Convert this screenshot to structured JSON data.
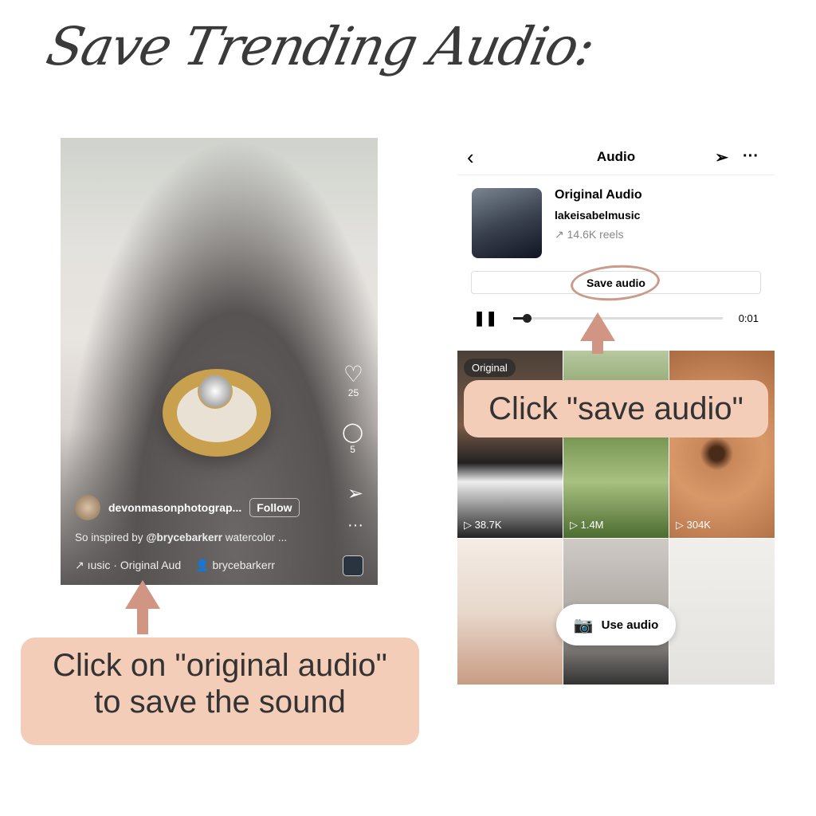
{
  "title": "Save Trending Audio:",
  "reel": {
    "likes": "25",
    "comments": "5",
    "username": "devonmasonphotograp...",
    "follow": "Follow",
    "caption_prefix": "So inspired by ",
    "caption_mention": "@brycebarkerr",
    "caption_suffix": " watercolor ...",
    "audio": "↗ ıusic · Original Aud",
    "tagged_user": "brycebarkerr"
  },
  "audio_page": {
    "header": "Audio",
    "track_title": "Original Audio",
    "artist": "lakeisabelmusic",
    "reels": "↗ 14.6K reels",
    "save_label": "Save audio",
    "time": "0:01",
    "original_badge": "Original",
    "views": [
      "38.7K",
      "1.4M",
      "304K"
    ],
    "use_audio": "Use audio"
  },
  "callouts": {
    "left": "Click on \"original audio\" to save the sound",
    "right": "Click \"save audio\""
  },
  "colors": {
    "callout": "#f4cdb8",
    "arrow": "#d09683"
  }
}
